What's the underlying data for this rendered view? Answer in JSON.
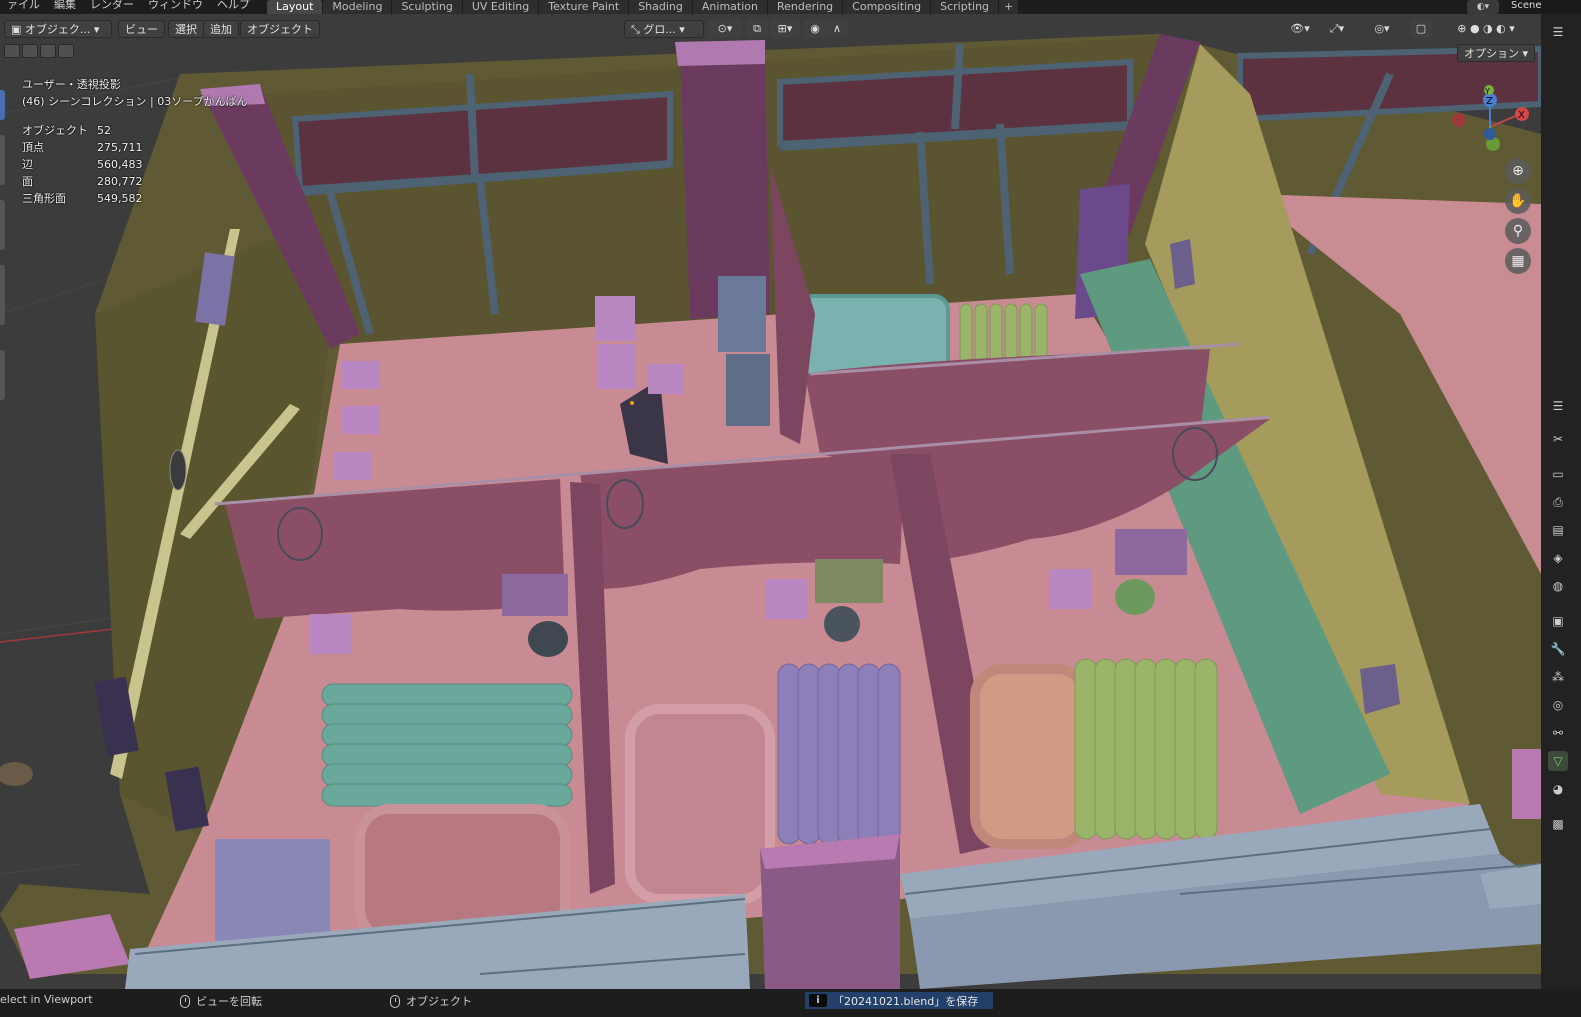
{
  "topbar": {
    "menus": [
      "ァイル",
      "編集",
      "レンダー",
      "ウィンドウ",
      "ヘルプ"
    ],
    "workspaces": [
      "Layout",
      "Modeling",
      "Sculpting",
      "UV Editing",
      "Texture Paint",
      "Shading",
      "Animation",
      "Rendering",
      "Compositing",
      "Scripting"
    ],
    "active_workspace": "Layout",
    "add_tab": "+",
    "scene": "Scene"
  },
  "viewport_header": {
    "mode": "オブジェク...",
    "menu_view": "ビュー",
    "menu_select": "選択",
    "menu_add": "追加",
    "menu_object": "オブジェクト",
    "transform_orientation": "グロ...",
    "options": "オプション"
  },
  "overlay": {
    "view_name": "ユーザー・透視投影",
    "collection": "(46) シーンコレクション | 03ソープかんばん",
    "stats": [
      {
        "label": "オブジェクト",
        "value": "52"
      },
      {
        "label": "頂点",
        "value": "275,711"
      },
      {
        "label": "辺",
        "value": "560,483"
      },
      {
        "label": "面",
        "value": "280,772"
      },
      {
        "label": "三角形面",
        "value": "549,582"
      }
    ]
  },
  "gizmo": {
    "x": "X",
    "y": "Y",
    "z": "Z"
  },
  "statusbar": {
    "select_hint": "elect in Viewport",
    "rotate_hint": "ビューを回転",
    "object_hint": "オブジェクト",
    "message": "「20241021.blend」を保存",
    "info_icon": "i"
  },
  "colors": {
    "floor": "#c88a93",
    "wall_olive": "#6b6233",
    "beam": "#5b6f7f",
    "pillar": "#8a5a86",
    "curtain": "#8a4f66",
    "mat_teal": "#6aa89b",
    "mat_green": "#9ab56a",
    "mat_purple": "#8d80b8",
    "tub_teal": "#79b2ae",
    "grid_bg": "#3c3c3c"
  }
}
